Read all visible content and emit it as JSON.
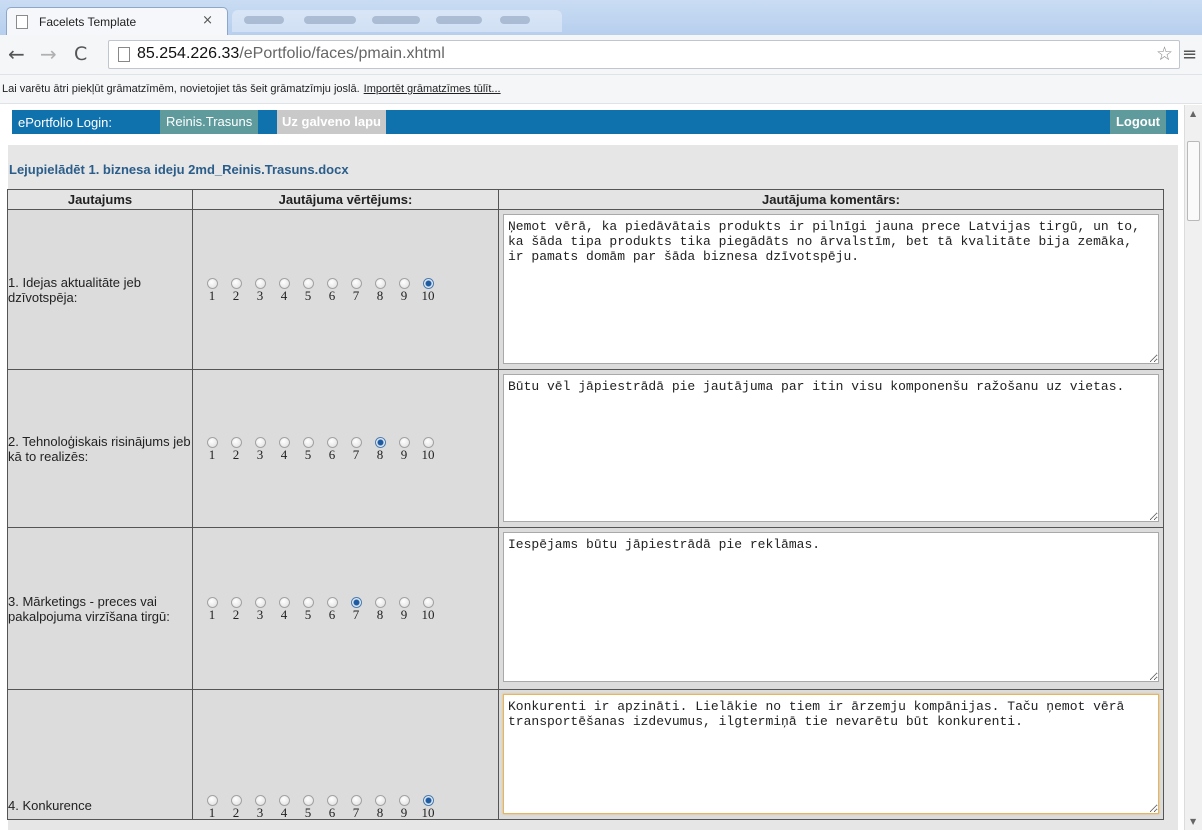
{
  "browser": {
    "tab_title": "Facelets Template",
    "tab_close": "×",
    "url_host": "85.254.226.33",
    "url_path": "/ePortfolio/faces/pmain.xhtml",
    "back_icon": "←",
    "forward_icon": "→",
    "reload_icon": "C",
    "star_icon": "☆",
    "menu_icon": "≡"
  },
  "bookmarks": {
    "message": "Lai varētu ātri piekļūt grāmatzīmēm, novietojiet tās šeit grāmatzīmju joslā.",
    "import_link": "Importēt grāmatzīmes tūlīt..."
  },
  "appbar": {
    "login_label": "ePortfolio Login:",
    "username": "Reinis.Trasuns",
    "home_link": "Uz galveno lapu",
    "logout": "Logout",
    "bar_color": "#1072ad",
    "tab_color": "#5f9a9c"
  },
  "download_link": "Lejupielādēt 1. biznesa ideju 2md_Reinis.Trasuns.docx",
  "table": {
    "headers": [
      "Jautajums",
      "Jautājuma vērtējums:",
      "Jautājuma komentārs:"
    ],
    "scale": [
      "1",
      "2",
      "3",
      "4",
      "5",
      "6",
      "7",
      "8",
      "9",
      "10"
    ],
    "rows": [
      {
        "question": "1. Idejas aktualitāte jeb dzīvotspēja:",
        "rating": 10,
        "comment": "Ņemot vērā, ka piedāvātais produkts ir pilnīgi jauna prece Latvijas tirgū, un to, ka šāda tipa produkts tika piegādāts no ārvalstīm, bet tā kvalitāte bija zemāka, ir pamats domām par šāda biznesa dzīvotspēju."
      },
      {
        "question": "2. Tehnoloģiskais risinājums jeb kā to realizēs:",
        "rating": 8,
        "comment": "Būtu vēl jāpiestrādā pie jautājuma par itin visu komponenšu ražošanu uz vietas."
      },
      {
        "question": "3. Mārketings - preces vai pakalpojuma virzīšana tirgū:",
        "rating": 7,
        "comment": "Iespējams būtu jāpiestrādā pie reklāmas."
      },
      {
        "question": "4. Konkurence",
        "rating": 10,
        "comment": "Konkurenti ir apzināti. Lielākie no tiem ir ārzemju kompānijas. Taču ņemot vērā transportēšanas izdevumus, ilgtermiņā tie nevarētu būt konkurenti."
      }
    ]
  }
}
